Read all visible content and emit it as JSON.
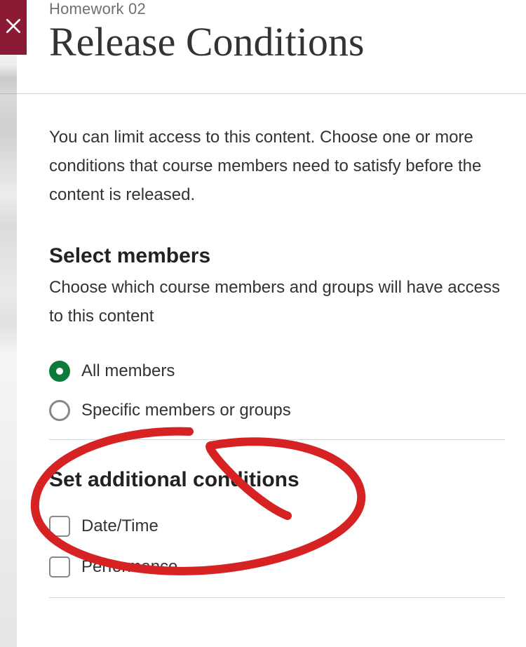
{
  "breadcrumb": "Homework 02",
  "title": "Release Conditions",
  "description": "You can limit access to this content. Choose one or more conditions that course members need to satisfy before the content is released.",
  "members": {
    "heading": "Select members",
    "subtext": "Choose which course members and groups will have access to this content",
    "options": {
      "all": "All members",
      "specific": "Specific members or groups"
    }
  },
  "conditions": {
    "heading": "Set additional conditions",
    "dateTime": "Date/Time",
    "performance": "Performance"
  }
}
